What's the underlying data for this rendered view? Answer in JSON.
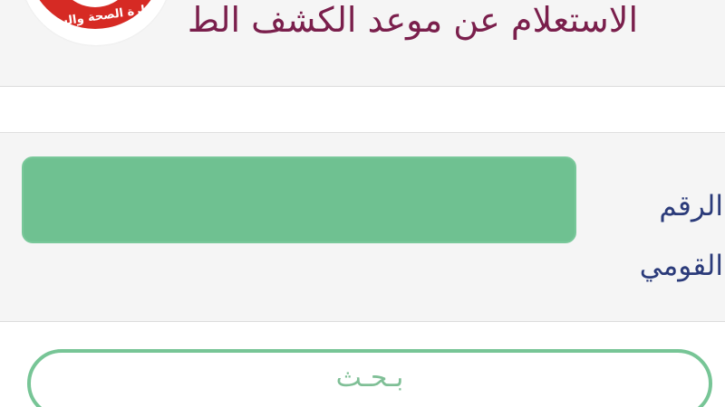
{
  "header": {
    "title": "الاستعلام عن موعد الكشف الط",
    "logo_text": "وزارة الصحة والسكان"
  },
  "form": {
    "national_id_label_line1": "الرقم",
    "national_id_label_line2": "القومي",
    "national_id_value": ""
  },
  "search_button": {
    "label": "بـحـث"
  },
  "colors": {
    "header_title": "#7a1f4c",
    "label": "#2b3b7a",
    "input_fill": "#6fc191",
    "button_border": "#77c596",
    "button_text": "#7fbf96",
    "logo_red": "#d62a24"
  }
}
